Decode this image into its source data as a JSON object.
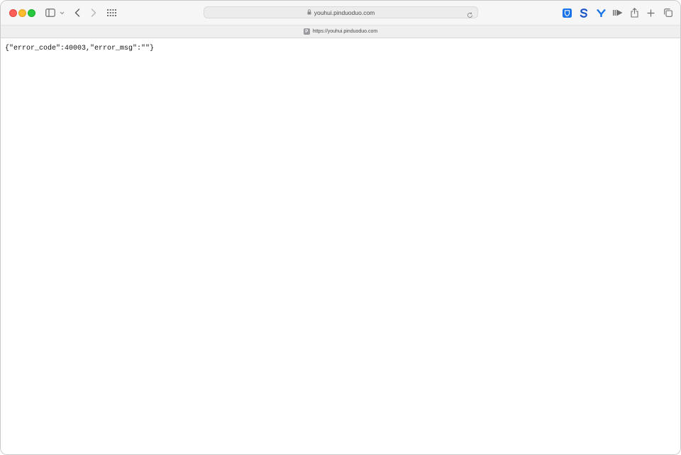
{
  "browser": {
    "address_bar": {
      "url": "youhui.pinduoduo.com"
    },
    "tab": {
      "favicon_letter": "P",
      "label": "https://youhui.pinduoduo.com"
    },
    "toolbar_icons": [
      "sidebar-icon",
      "chevron-down-icon",
      "back-icon",
      "forward-icon",
      "grid-icon",
      "bitwarden-icon",
      "s-extension-icon",
      "y-extension-icon",
      "reader-icon",
      "share-icon",
      "plus-icon",
      "tabs-overview-icon"
    ],
    "colors": {
      "extension_blue": "#1a73e8",
      "traffic_red": "#ff5f57",
      "traffic_yellow": "#febc2e",
      "traffic_green": "#28c840"
    }
  },
  "page": {
    "body_text": "{\"error_code\":40003,\"error_msg\":\"\"}"
  }
}
